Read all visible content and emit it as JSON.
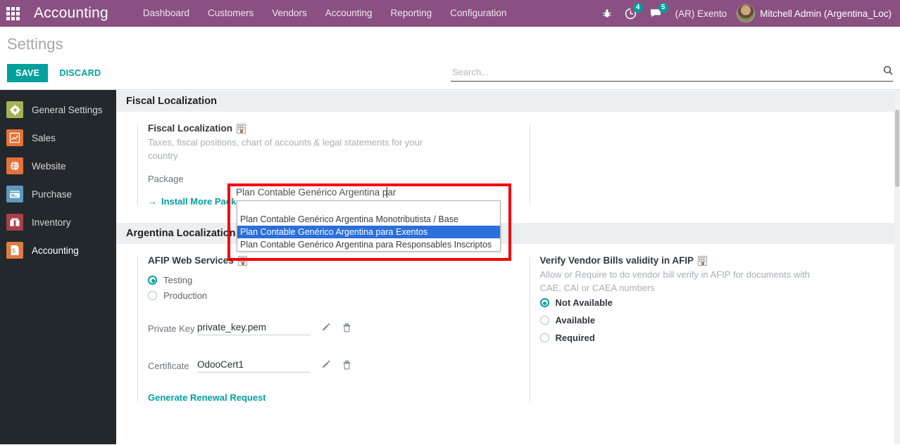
{
  "navbar": {
    "apps_icon": "apps-grid-icon",
    "brand": "Accounting",
    "menu": [
      {
        "label": "Dashboard"
      },
      {
        "label": "Customers"
      },
      {
        "label": "Vendors"
      },
      {
        "label": "Accounting"
      },
      {
        "label": "Reporting"
      },
      {
        "label": "Configuration"
      }
    ],
    "debug_icon": "bug-icon",
    "activities": {
      "icon": "clock-icon",
      "count": "4"
    },
    "messages": {
      "icon": "chat-icon",
      "count": "5"
    },
    "company": "(AR) Exento",
    "avatar_icon": "user-avatar",
    "user": "Mitchell Admin (Argentina_Loc)"
  },
  "control_panel": {
    "breadcrumb": "Settings",
    "save_label": "SAVE",
    "discard_label": "DISCARD",
    "search": {
      "placeholder": "Search...",
      "value": "",
      "icon": "search-icon"
    }
  },
  "sidebar": {
    "items": [
      {
        "label": "General Settings",
        "icon": "gear-icon",
        "glyph": "⚙"
      },
      {
        "label": "Sales",
        "icon": "chart-line-icon",
        "glyph": "↗"
      },
      {
        "label": "Website",
        "icon": "globe-icon",
        "glyph": "◔"
      },
      {
        "label": "Purchase",
        "icon": "credit-card-icon",
        "glyph": "▤"
      },
      {
        "label": "Inventory",
        "icon": "box-icon",
        "glyph": "✉"
      },
      {
        "label": "Accounting",
        "icon": "invoice-icon",
        "glyph": "$"
      }
    ],
    "active_index": 5
  },
  "sections": {
    "fiscal_localization": {
      "title": "Fiscal Localization",
      "setting_title": "Fiscal Localization",
      "setting_icon": "company-icon",
      "description": "Taxes, fiscal positions, chart of accounts & legal statements for your country",
      "package_label": "Package",
      "install_link": "Install More Packages",
      "install_arrow": "→"
    },
    "argentina_localization": {
      "title": "Argentina Localization",
      "afip": {
        "title": "AFIP Web Services",
        "icon": "company-icon",
        "options": [
          {
            "label": "Testing",
            "selected": true
          },
          {
            "label": "Production",
            "selected": false
          }
        ],
        "private_key_label": "Private Key",
        "private_key_value": "private_key.pem",
        "certificate_label": "Certificate",
        "certificate_value": "OdooCert1",
        "edit_icon": "pencil-icon",
        "delete_icon": "trash-icon",
        "renewal_link": "Generate Renewal Request"
      },
      "verify": {
        "title": "Verify Vendor Bills validity in AFIP",
        "icon": "company-icon",
        "description": "Allow or Require to do vendor bill verify in AFIP for documents with CAE, CAI or CAEA numbers",
        "options": [
          {
            "label": "Not Available",
            "selected": true
          },
          {
            "label": "Available",
            "selected": false
          },
          {
            "label": "Required",
            "selected": false
          }
        ]
      }
    }
  },
  "package_dropdown": {
    "input_value": "Plan Contable Genérico Argentina par",
    "highlight_color": "#f50000",
    "selected_color": "#2a6fdb",
    "options": [
      {
        "label": "Plan Contable Genérico Argentina Monotributista / Base",
        "selected": false
      },
      {
        "label": "Plan Contable Genérico Argentina para Exentos",
        "selected": true
      },
      {
        "label": "Plan Contable Genérico Argentina para Responsables Inscriptos",
        "selected": false
      }
    ]
  },
  "colors": {
    "navbar": "#8a5082",
    "accent": "#00a09d",
    "sidebar": "#23282d"
  }
}
